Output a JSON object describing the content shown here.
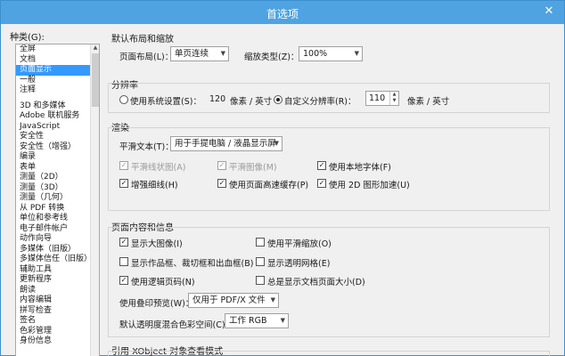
{
  "window": {
    "title": "首选项",
    "close_glyph": "✕"
  },
  "categories": {
    "label": "种类(G):",
    "group1": [
      "全屏",
      "文档",
      "页面显示",
      "一般",
      "注释"
    ],
    "selected": "页面显示",
    "group2": [
      "3D 和多媒体",
      "Adobe 联机服务",
      "JavaScript",
      "安全性",
      "安全性（增强）",
      "编录",
      "表单",
      "测量（2D）",
      "测量（3D）",
      "测量（几何）",
      "从 PDF 转换",
      "单位和参考线",
      "电子邮件帐户",
      "动作向导",
      "多媒体（旧版）",
      "多媒体信任（旧版）",
      "辅助工具",
      "更新程序",
      "朗读",
      "内容编辑",
      "拼写检查",
      "签名",
      "色彩管理",
      "身份信息"
    ]
  },
  "layout_zoom": {
    "title": "默认布局和缩放",
    "layout_label": "页面布局(L)：",
    "layout_value": "单页连续",
    "zoom_label": "缩放类型(Z)：",
    "zoom_value": "100%"
  },
  "resolution": {
    "title": "分辨率",
    "system_label": "使用系统设置(S)：",
    "system_value": "120",
    "unit1": "像素 / 英寸",
    "custom_label": "自定义分辨率(R)：",
    "custom_value": "110",
    "unit2": "像素 / 英寸"
  },
  "rendering": {
    "title": "渲染",
    "smooth_label": "平滑文本(T)：",
    "smooth_value": "用于手提电脑 / 液晶显示屏",
    "options": [
      {
        "label": "平滑线状图(A)",
        "checked": true,
        "disabled": true
      },
      {
        "label": "平滑图像(M)",
        "checked": true,
        "disabled": true
      },
      {
        "label": "使用本地字体(F)",
        "checked": true,
        "disabled": false
      },
      {
        "label": "增强细线(H)",
        "checked": true,
        "disabled": false
      },
      {
        "label": "使用页面高速缓存(P)",
        "checked": true,
        "disabled": false
      },
      {
        "label": "使用 2D 图形加速(U)",
        "checked": true,
        "disabled": false
      }
    ]
  },
  "page_content": {
    "title": "页面内容和信息",
    "options": [
      {
        "label": "显示大图像(I)",
        "checked": true
      },
      {
        "label": "使用平滑缩放(O)",
        "checked": false
      },
      {
        "label": "显示作品框、裁切框和出血框(B)",
        "checked": false
      },
      {
        "label": "显示透明网格(E)",
        "checked": false
      },
      {
        "label": "使用逻辑页码(N)",
        "checked": true
      },
      {
        "label": "总是显示文档页面大小(D)",
        "checked": false
      }
    ],
    "overprint_label": "使用叠印预览(W)：",
    "overprint_value": "仅用于 PDF/X 文件",
    "blend_label": "默认透明度混合色彩空间(C)：",
    "blend_value": "工作 RGB"
  },
  "xobject": {
    "title": "引用 XObject 对象查看模式"
  },
  "icons": {
    "check": "✓",
    "dropdown": "▼",
    "spin_up": "▲",
    "spin_down": "▼",
    "scroll_up": "▲"
  }
}
